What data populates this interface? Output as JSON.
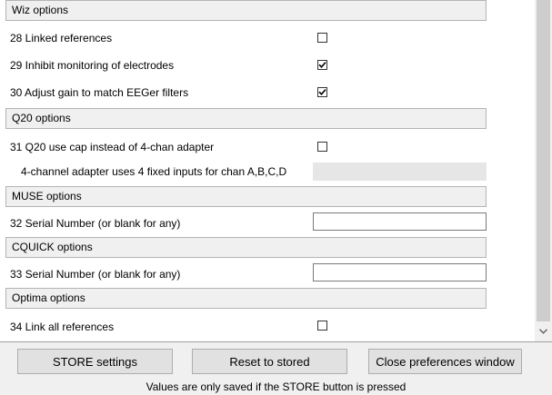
{
  "sections": {
    "wiz": "Wiz options",
    "q20": "Q20 options",
    "muse": "MUSE options",
    "cquick": "CQUICK options",
    "optima": "Optima options"
  },
  "options": {
    "o28": {
      "label": "28 Linked references",
      "checked": false
    },
    "o29": {
      "label": "29 Inhibit monitoring of electrodes",
      "checked": true
    },
    "o30": {
      "label": "30 Adjust gain to match EEGer filters",
      "checked": true
    },
    "o31": {
      "label": "31 Q20 use cap instead of 4-chan adapter",
      "checked": false
    },
    "q20_info": {
      "label": "4-channel adapter uses 4 fixed inputs for chan A,B,C,D",
      "value": ""
    },
    "o32": {
      "label": "32 Serial Number (or blank for any)",
      "value": ""
    },
    "o33": {
      "label": "33 Serial Number (or blank for any)",
      "value": ""
    },
    "o34": {
      "label": "34 Link all references",
      "checked": false
    }
  },
  "buttons": {
    "store": "STORE settings",
    "reset": "Reset to stored",
    "close": "Close preferences window"
  },
  "footer": "Values are only saved if the STORE button is pressed",
  "icons": {
    "check": "checkmark-icon",
    "scroll_down": "chevron-down-icon"
  }
}
